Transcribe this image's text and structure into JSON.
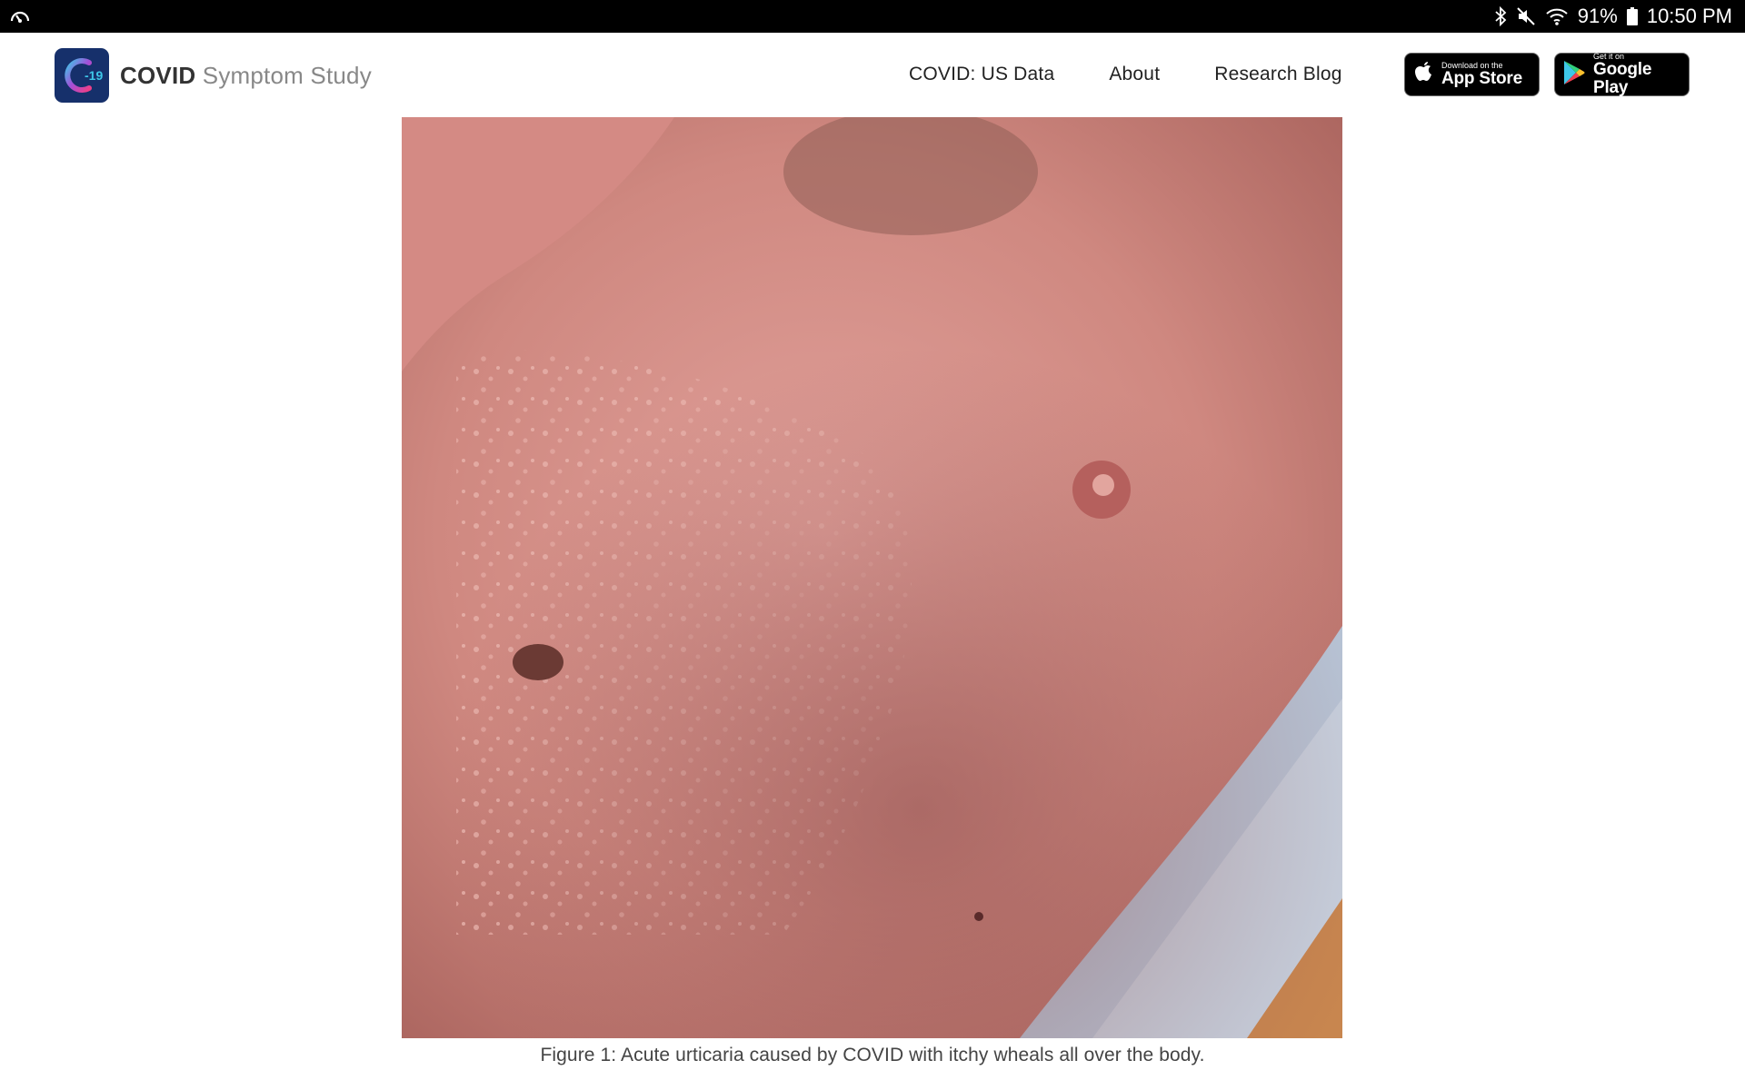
{
  "status_bar": {
    "left_icon": "speedometer-icon",
    "icons": [
      "bluetooth-icon",
      "mute-icon",
      "wifi-icon"
    ],
    "battery": "91%",
    "time": "10:50 PM"
  },
  "brand": {
    "logo_text": "-19",
    "name_strong": "COVID",
    "name_light": "Symptom Study",
    "logo_color": "#16306b"
  },
  "nav": {
    "items": [
      {
        "label": "COVID: US Data"
      },
      {
        "label": "About"
      },
      {
        "label": "Research Blog"
      }
    ]
  },
  "store_buttons": {
    "appstore": {
      "small": "Download on the",
      "big": "App Store",
      "icon": "apple-icon"
    },
    "googleplay": {
      "small": "Get it on",
      "big": "Google Play",
      "icon": "google-play-icon"
    }
  },
  "figure": {
    "caption": "Figure 1: Acute urticaria caused by COVID with itchy wheals all over the body."
  }
}
